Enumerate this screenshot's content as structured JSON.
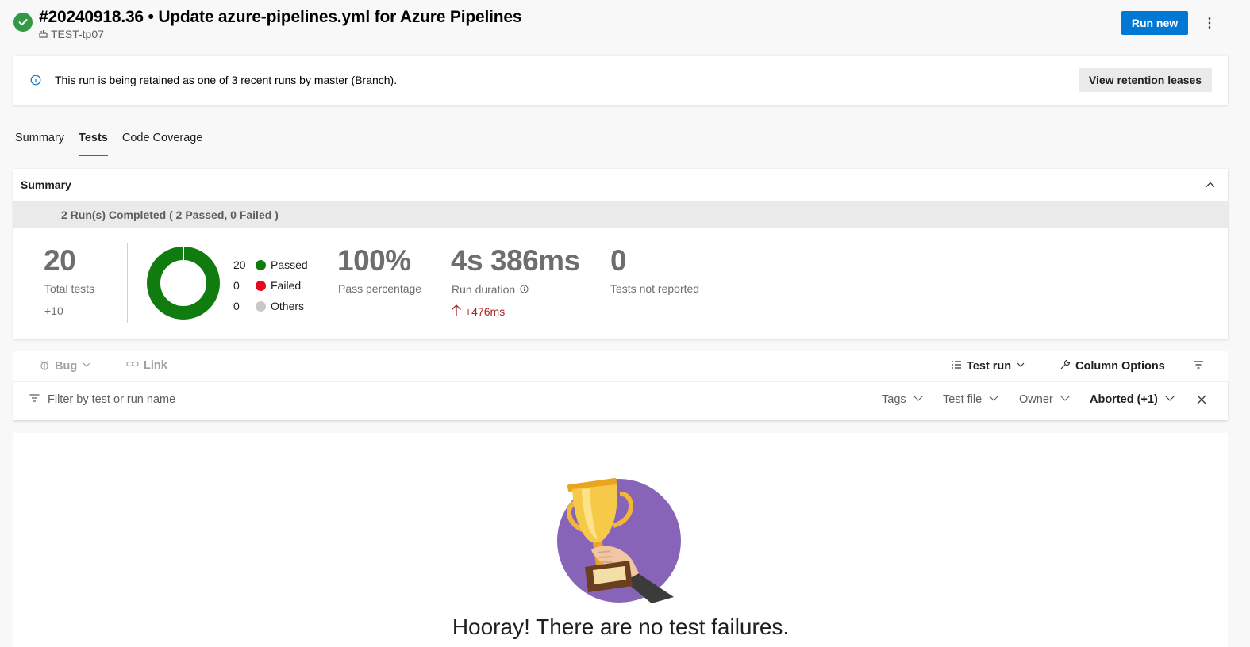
{
  "header": {
    "run_title": "#20240918.36 • Update azure-pipelines.yml for Azure Pipelines",
    "repo": "TEST-tp07",
    "run_new_label": "Run new",
    "more_label": "⋮"
  },
  "banner": {
    "text": "This run is being retained as one of 3 recent runs by master (Branch).",
    "button_label": "View retention leases"
  },
  "tabs": [
    {
      "label": "Summary",
      "active": false
    },
    {
      "label": "Tests",
      "active": true
    },
    {
      "label": "Code Coverage",
      "active": false
    }
  ],
  "summary": {
    "heading": "Summary",
    "runs_completed": "2 Run(s) Completed ( 2 Passed, 0 Failed )",
    "total_tests": {
      "value": "20",
      "label": "Total tests",
      "delta": "+10"
    },
    "legend": [
      {
        "count": "20",
        "label": "Passed",
        "color": "#107c10"
      },
      {
        "count": "0",
        "label": "Failed",
        "color": "#e00b1c"
      },
      {
        "count": "0",
        "label": "Others",
        "color": "#c8c8c8"
      }
    ],
    "pass_percentage": {
      "value": "100%",
      "label": "Pass percentage"
    },
    "run_duration": {
      "value": "4s 386ms",
      "label": "Run duration",
      "delta": "+476ms"
    },
    "not_reported": {
      "value": "0",
      "label": "Tests not reported"
    }
  },
  "toolbar": {
    "bug_label": "Bug",
    "link_label": "Link",
    "test_run_label": "Test run",
    "column_options_label": "Column Options"
  },
  "filters": {
    "placeholder": "Filter by test or run name",
    "tags": "Tags",
    "test_file": "Test file",
    "owner": "Owner",
    "outcome": "Aborted (+1)"
  },
  "empty_state": {
    "message": "Hooray! There are no test failures."
  },
  "colors": {
    "accent": "#0078d4",
    "success": "#339947",
    "passed": "#107c10",
    "trophy_bg": "#8764b8",
    "delta_red": "#a4262c"
  }
}
